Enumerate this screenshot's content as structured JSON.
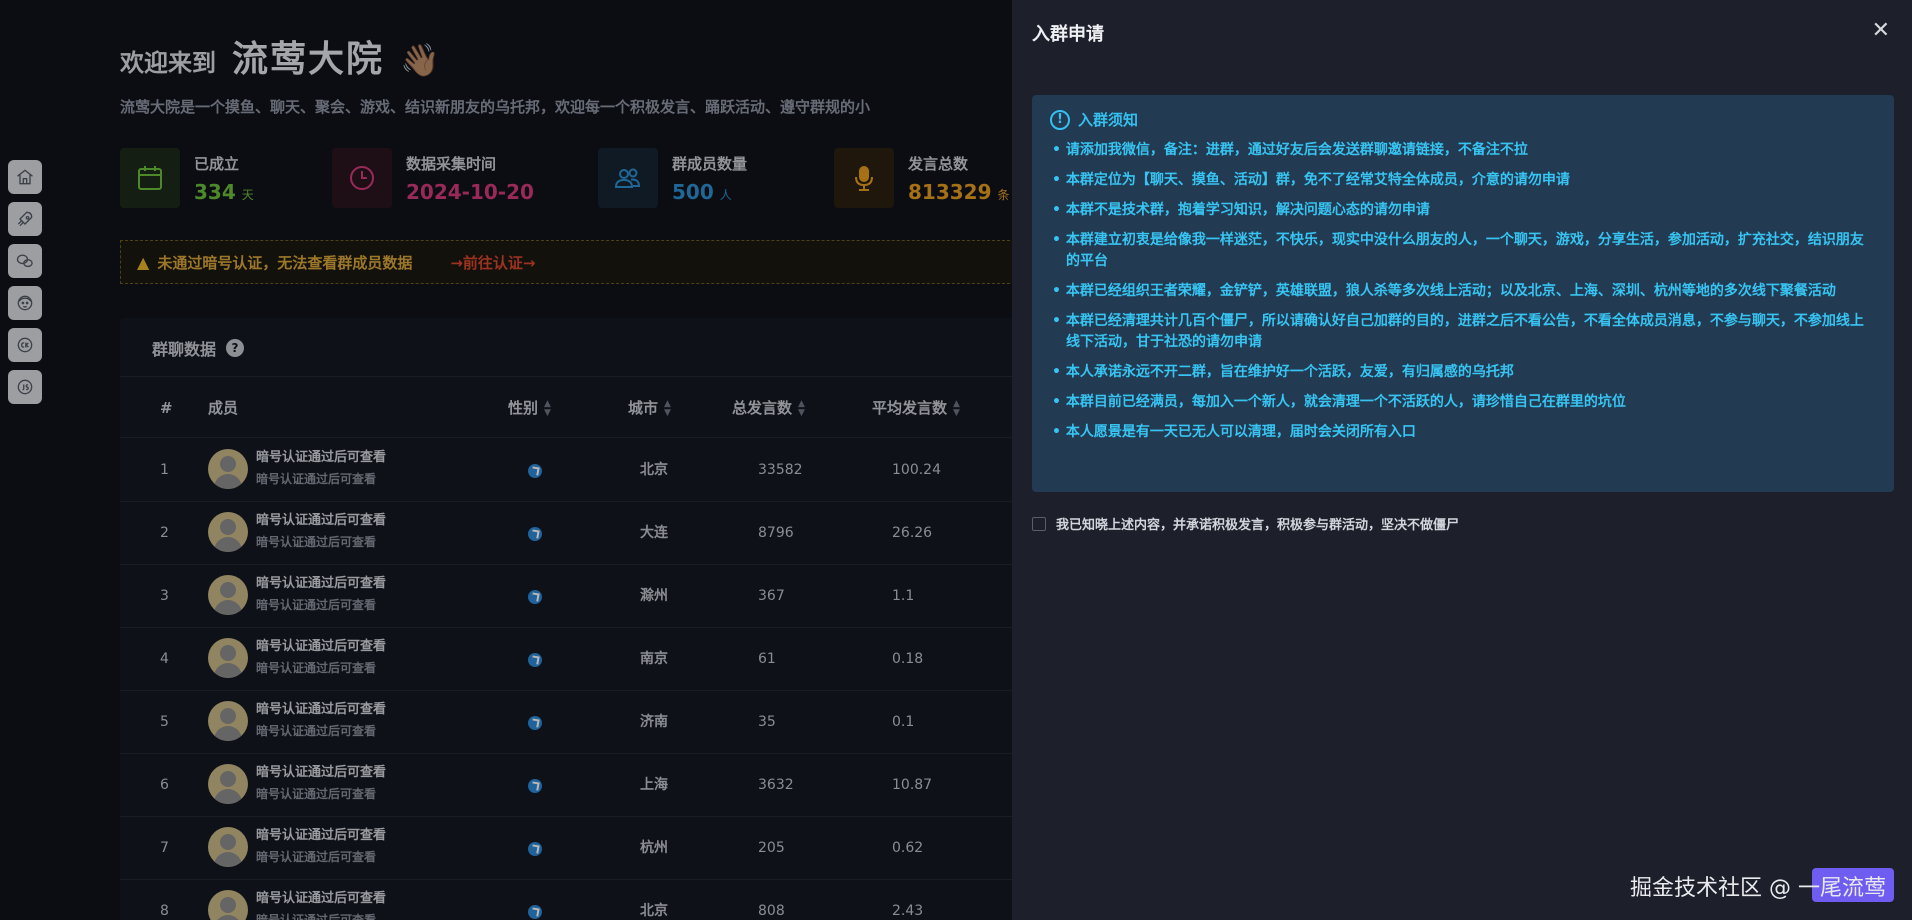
{
  "header": {
    "welcome_prefix": "欢迎来到",
    "group_name": "流莺大院",
    "wave_emoji": "👋🏽",
    "intro": "流莺大院是一个摸鱼、聊天、聚会、游戏、结识新朋友的乌托邦，欢迎每一个积极发言、踊跃活动、遵守群规的小"
  },
  "stats": [
    {
      "label": "已成立",
      "value": "334",
      "unit": "天",
      "color": "#6bbd3c",
      "icon": "calendar-icon"
    },
    {
      "label": "数据采集时间",
      "value": "2024-10-20",
      "unit": "",
      "color": "#d43a7c",
      "icon": "clock-icon"
    },
    {
      "label": "群成员数量",
      "value": "500",
      "unit": "人",
      "color": "#2b8fd0",
      "icon": "users-icon"
    },
    {
      "label": "发言总数",
      "value": "813329",
      "unit": "条",
      "color": "#e69b1e",
      "icon": "microphone-icon"
    }
  ],
  "warning": {
    "text": "未通过暗号认证，无法查看群成员数据",
    "link": "→前往认证→"
  },
  "card": {
    "title": "群聊数据",
    "columns": {
      "index": "#",
      "member": "成员",
      "gender": "性别",
      "city": "城市",
      "total": "总发言数",
      "avg": "平均发言数"
    }
  },
  "rows": [
    {
      "idx": "1",
      "name": "暗号认证通过后可查看",
      "sub": "暗号认证通过后可查看",
      "city": "北京",
      "total": "33582",
      "avg": "100.24"
    },
    {
      "idx": "2",
      "name": "暗号认证通过后可查看",
      "sub": "暗号认证通过后可查看",
      "city": "大连",
      "total": "8796",
      "avg": "26.26"
    },
    {
      "idx": "3",
      "name": "暗号认证通过后可查看",
      "sub": "暗号认证通过后可查看",
      "city": "滁州",
      "total": "367",
      "avg": "1.1"
    },
    {
      "idx": "4",
      "name": "暗号认证通过后可查看",
      "sub": "暗号认证通过后可查看",
      "city": "南京",
      "total": "61",
      "avg": "0.18"
    },
    {
      "idx": "5",
      "name": "暗号认证通过后可查看",
      "sub": "暗号认证通过后可查看",
      "city": "济南",
      "total": "35",
      "avg": "0.1"
    },
    {
      "idx": "6",
      "name": "暗号认证通过后可查看",
      "sub": "暗号认证通过后可查看",
      "city": "上海",
      "total": "3632",
      "avg": "10.87"
    },
    {
      "idx": "7",
      "name": "暗号认证通过后可查看",
      "sub": "暗号认证通过后可查看",
      "city": "杭州",
      "total": "205",
      "avg": "0.62"
    },
    {
      "idx": "8",
      "name": "暗号认证通过后可查看",
      "sub": "暗号认证通过后可查看",
      "city": "北京",
      "total": "808",
      "avg": "2.43"
    }
  ],
  "rail": [
    "home-icon",
    "rocket-icon",
    "wechat-icon",
    "face-icon",
    "ck-icon",
    "js-icon"
  ],
  "drawer": {
    "title": "入群申请",
    "close_glyph": "✕",
    "notice_title": "入群须知",
    "rules": [
      "请添加我微信，备注：进群，通过好友后会发送群聊邀请链接，不备注不拉",
      "本群定位为【聊天、摸鱼、活动】群，免不了经常艾特全体成员，介意的请勿申请",
      "本群不是技术群，抱着学习知识，解决问题心态的请勿申请",
      "本群建立初衷是给像我一样迷茫，不快乐，现实中没什么朋友的人，一个聊天，游戏，分享生活，参加活动，扩充社交，结识朋友的平台",
      "本群已经组织王者荣耀，金铲铲，英雄联盟，狼人杀等多次线上活动；以及北京、上海、深圳、杭州等地的多次线下聚餐活动",
      "本群已经清理共计几百个僵尸，所以请确认好自己加群的目的，进群之后不看公告，不看全体成员消息，不参与聊天，不参加线上线下活动，甘于社恐的请勿申请",
      "本人承诺永远不开二群，旨在维护好一个活跃，友爱，有归属感的乌托邦",
      "本群目前已经满员，每加入一个新人，就会清理一个不活跃的人，请珍惜自己在群里的坑位",
      "本人愿景是有一天已无人可以清理，届时会关闭所有入口"
    ],
    "agree_text": "我已知晓上述内容，并承诺积极发言，积极参与群活动，坚决不做僵尸",
    "agree_checked": false
  },
  "watermark": "掘金技术社区 @ 一尾流莺"
}
